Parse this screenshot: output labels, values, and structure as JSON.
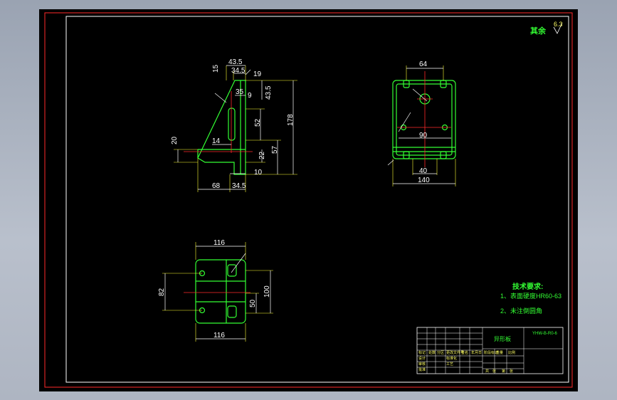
{
  "drawing": {
    "surface_note": "其余",
    "roughness": "6.3",
    "tech_title": "技术要求:",
    "tech_items": [
      "1、表面硬度HR60-63",
      "2、未注倒圆角"
    ],
    "colors": {
      "background": "#000000",
      "frame": "#ff2a2a",
      "outline": "#33ff33",
      "dimension": "#ffffff",
      "extension": "#ffff33",
      "centerline": "#ff2a2a",
      "cyan": "#33ffff",
      "magenta": "#ff33ff"
    }
  },
  "front_view": {
    "dims_top": [
      "43.5",
      "34.5",
      "19",
      "15"
    ],
    "dims_mid": [
      "35",
      "9",
      "43.5",
      "52",
      "14",
      "22",
      "57",
      "178"
    ],
    "dims_left": [
      "20"
    ],
    "dims_bottom": [
      "68",
      "34.5",
      "10"
    ]
  },
  "side_view": {
    "dims": [
      "64",
      "90",
      "40",
      "140"
    ]
  },
  "top_view": {
    "dims": [
      "116",
      "82",
      "100",
      "50",
      "116"
    ]
  },
  "title_block": {
    "name": "异形板",
    "code": "YHW-B-R0-6",
    "labels": [
      "标记",
      "处数",
      "分区",
      "更改文件号",
      "签名",
      "年月日",
      "设计",
      "标准化",
      "审核",
      "工艺",
      "批准",
      "阶段标记",
      "重量",
      "比例",
      "共",
      "张",
      "第",
      "张"
    ]
  }
}
